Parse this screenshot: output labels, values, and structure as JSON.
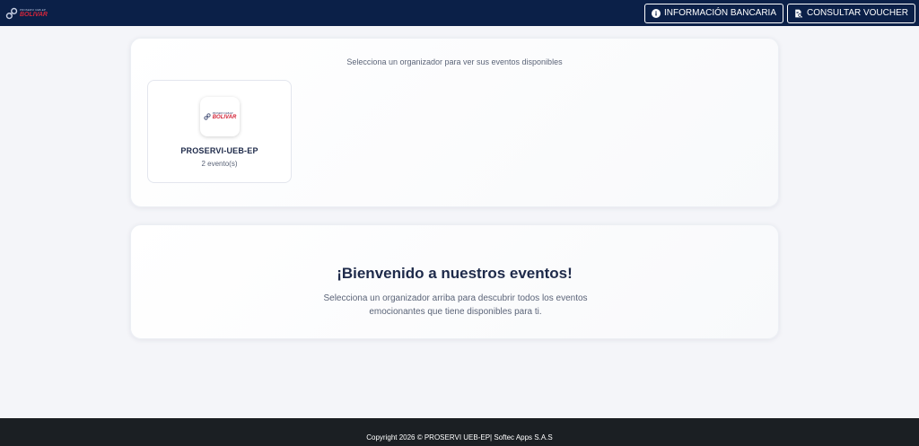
{
  "header": {
    "brand_top": "PROSERVI UEB-EP",
    "brand_name": "BOLIVAR",
    "buttons": {
      "bank_info": "INFORMACIÓN BANCARIA",
      "voucher": "CONSULTAR VOUCHER"
    }
  },
  "organizers": {
    "hint": "Selecciona un organizador para ver sus eventos disponibles",
    "items": [
      {
        "logo_top": "PROSERVI UEB-EP",
        "logo_name": "BOLIVAR",
        "name": "PROSERVI-UEB-EP",
        "count": "2 evento(s)"
      }
    ]
  },
  "welcome": {
    "title": "¡Bienvenido a nuestros eventos!",
    "text": "Selecciona un organizador arriba para descubrir todos los eventos emocionantes que tiene disponibles para ti."
  },
  "footer": {
    "copyright": "Copyright 2026 © PROSERVI UEB-EP| Softec Apps S.A.S"
  },
  "colors": {
    "navbar": "#0b2048",
    "brand_red": "#d3263a",
    "footer": "#1b1f23",
    "background": "#f4f5f9"
  },
  "icons": {
    "brand": "link-chain-icon",
    "bank_info": "info-circle-icon",
    "voucher": "document-search-icon"
  }
}
